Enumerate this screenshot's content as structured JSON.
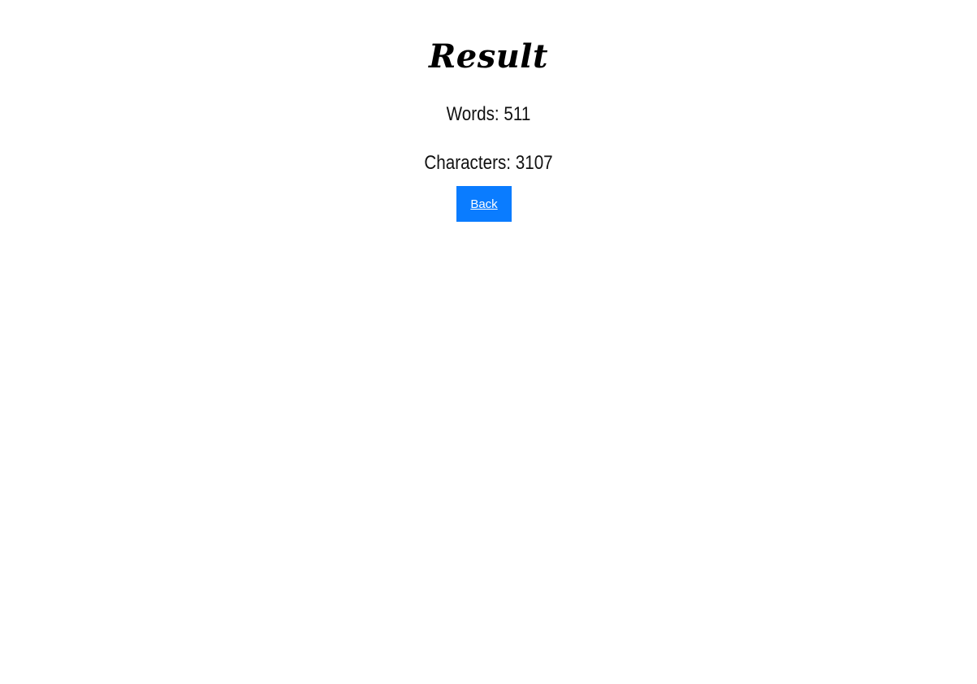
{
  "page": {
    "title": "Result"
  },
  "stats": {
    "words_label": "Words:",
    "words_value": "511",
    "characters_label": "Characters:",
    "characters_value": "3107"
  },
  "actions": {
    "back_label": "Back"
  },
  "hero": {
    "icon": "notebook-and-pen-on-wood-image",
    "colors": {
      "wood_dark": "#6e6e6e",
      "wood_light": "#b9b9b9",
      "paper": "#e9e6dc",
      "pen": "#1f3e78",
      "button": "#0a7cff"
    }
  }
}
